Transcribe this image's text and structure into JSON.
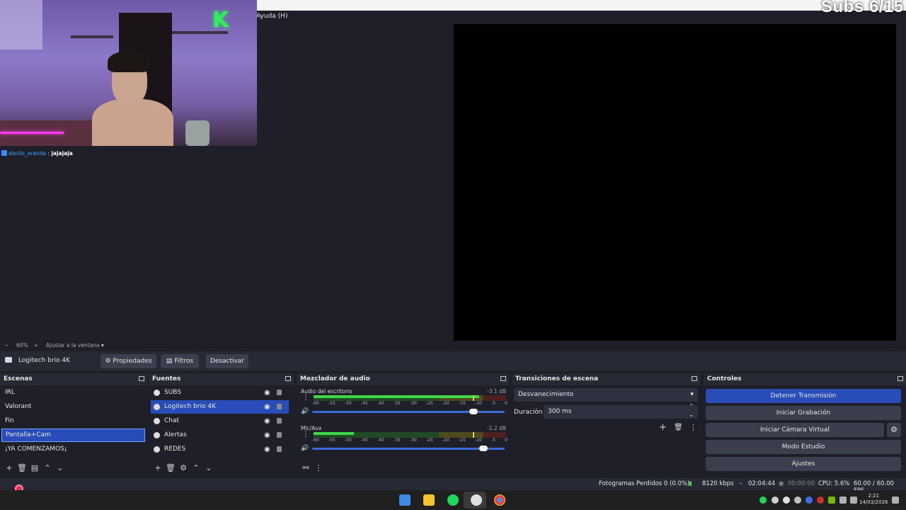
{
  "overlay": {
    "subs_counter": "Subs 6/15",
    "chat_user": "danilo_aranda",
    "chat_sep": ":",
    "chat_message": "jajajaja"
  },
  "menu": {
    "help": "Ayuda (H)"
  },
  "zoom": {
    "minus": "−",
    "level": "60%",
    "plus": "+",
    "fit": "Ajustar a la ventana",
    "caret": "▾"
  },
  "source_bar": {
    "selected_source": "Logitech brio 4K",
    "properties": "Propiedades",
    "filters": "Filtros",
    "deactivate": "Desactivar"
  },
  "scenes": {
    "title": "Escenas",
    "items": [
      "IRL",
      "Valorant",
      "Fin",
      "Pantalla+Cam",
      "¡YA COMENZAMOS¡"
    ],
    "selected_index": 3
  },
  "sources": {
    "title": "Fuentes",
    "items": [
      "SUBS",
      "Logitech brio 4K",
      "Chat",
      "Alertas",
      "REDES"
    ],
    "selected_index": 1
  },
  "mixer": {
    "title": "Mezclador de audio",
    "channels": [
      {
        "name": "Audio del escritorio",
        "db": "-3.1 dB",
        "level": 0.86,
        "volume": 0.86
      },
      {
        "name": "Mic/Aux",
        "db": "-1.2 dB",
        "level": 0.21,
        "volume": 0.91
      }
    ],
    "ticks": [
      "-60",
      "-55",
      "-50",
      "-45",
      "-40",
      "-35",
      "-30",
      "-25",
      "-20",
      "-15",
      "-10",
      "-5",
      "0"
    ]
  },
  "transitions": {
    "title": "Transiciones de escena",
    "selected": "Desvanecimiento",
    "duration_label": "Duración",
    "duration_value": "300 ms"
  },
  "controls": {
    "title": "Controles",
    "stop_stream": "Detener Transmisión",
    "start_recording": "Iniciar Grabación",
    "start_virtual_cam": "Iniciar Cámara Virtual",
    "studio_mode": "Modo Estudio",
    "settings": "Ajustes"
  },
  "status": {
    "dropped_frames": "Fotogramas Perdidos 0 (0.0%)",
    "bitrate": "8120 kbps",
    "live_time": "02:04:44",
    "rec_time": "00:00:00",
    "cpu": "CPU: 5.6%",
    "fps": "60.00 / 60.00 FPS"
  },
  "taskbar": {
    "time": "2:21",
    "date": "14/03/2026"
  },
  "colors": {
    "accent": "#284cb8",
    "panel": "#272934",
    "background": "#1e1f29"
  }
}
